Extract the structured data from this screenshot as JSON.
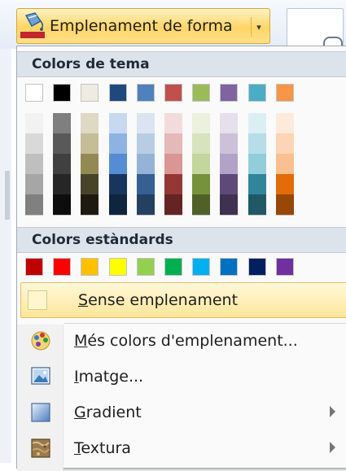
{
  "button": {
    "label": "Emplenament de forma",
    "icon": "paint-bucket-icon",
    "arrow": "▾",
    "accent_color": "#c0262b"
  },
  "theme_section": {
    "title": "Colors de tema",
    "base_colors": [
      "#ffffff",
      "#000000",
      "#eeece1",
      "#1f497d",
      "#4f81bd",
      "#c0504d",
      "#9bbb59",
      "#8064a2",
      "#4bacc6",
      "#f79646"
    ],
    "shade_columns": [
      [
        "#f2f2f2",
        "#d9d9d9",
        "#bfbfbf",
        "#a6a6a6",
        "#808080"
      ],
      [
        "#7f7f7f",
        "#595959",
        "#404040",
        "#262626",
        "#0d0d0d"
      ],
      [
        "#ddd9c3",
        "#c4bd97",
        "#938953",
        "#494429",
        "#1d1b10"
      ],
      [
        "#c6d9f0",
        "#8db3e2",
        "#548dd4",
        "#17365d",
        "#0f243e"
      ],
      [
        "#dbe5f1",
        "#b8cce4",
        "#95b3d7",
        "#366092",
        "#244061"
      ],
      [
        "#f2dcdb",
        "#e5b9b7",
        "#d99694",
        "#953734",
        "#632423"
      ],
      [
        "#ebf1dd",
        "#d7e3bc",
        "#c3d69b",
        "#76923c",
        "#4f6128"
      ],
      [
        "#e5e0ec",
        "#ccc1d9",
        "#b2a2c7",
        "#5f497a",
        "#3f3151"
      ],
      [
        "#dbeef3",
        "#b7dde8",
        "#92cddc",
        "#31859b",
        "#205867"
      ],
      [
        "#fdeada",
        "#fbd5b5",
        "#fac08f",
        "#e36c09",
        "#974806"
      ]
    ]
  },
  "standard_section": {
    "title": "Colors estàndards",
    "colors": [
      "#c00000",
      "#ff0000",
      "#ffc000",
      "#ffff00",
      "#92d050",
      "#00b050",
      "#00b0f0",
      "#0070c0",
      "#002060",
      "#7030a0"
    ]
  },
  "menu": {
    "no_fill": {
      "label_key": "S",
      "label_rest": "ense emplenament"
    },
    "more_colors": {
      "label_key": "M",
      "label_rest": "és colors d'emplenament...",
      "icon": "color-palette-icon"
    },
    "picture": {
      "label_key": "I",
      "label_rest": "matge...",
      "icon": "picture-icon"
    },
    "gradient": {
      "label_key": "G",
      "label_rest": "radient",
      "icon": "gradient-icon"
    },
    "texture": {
      "label_key": "T",
      "label_rest": "extura",
      "icon": "texture-icon"
    }
  }
}
